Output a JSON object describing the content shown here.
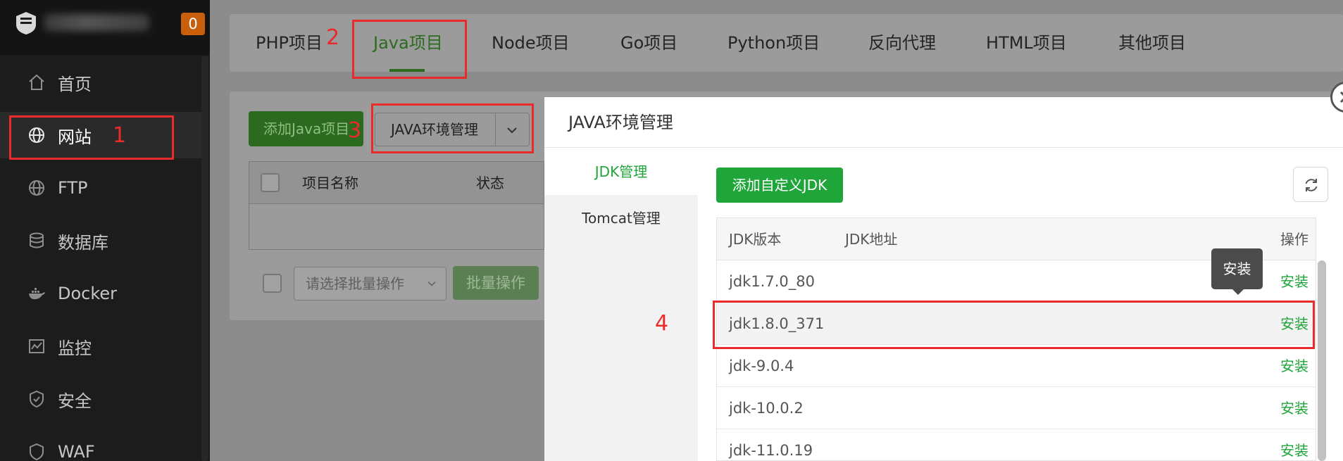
{
  "sidebar": {
    "badge": "0",
    "items": [
      {
        "label": "首页",
        "icon": "home-icon"
      },
      {
        "label": "网站",
        "icon": "globe-icon"
      },
      {
        "label": "FTP",
        "icon": "globe-icon"
      },
      {
        "label": "数据库",
        "icon": "database-icon"
      },
      {
        "label": "Docker",
        "icon": "docker-icon"
      },
      {
        "label": "监控",
        "icon": "monitor-icon"
      },
      {
        "label": "安全",
        "icon": "shield-icon"
      },
      {
        "label": "WAF",
        "icon": "waf-shield-icon"
      }
    ]
  },
  "tabs": [
    "PHP项目",
    "Java项目",
    "Node项目",
    "Go项目",
    "Python项目",
    "反向代理",
    "HTML项目",
    "其他项目"
  ],
  "toolbar": {
    "add_java_label": "添加Java项目",
    "java_env_label": "JAVA环境管理"
  },
  "project_table": {
    "headers": [
      "项目名称",
      "状态"
    ]
  },
  "bulk": {
    "select_placeholder": "请选择批量操作",
    "button_label": "批量操作"
  },
  "modal": {
    "title": "JAVA环境管理",
    "side_items": [
      "JDK管理",
      "Tomcat管理"
    ],
    "add_jdk_label": "添加自定义JDK",
    "table_headers": {
      "version": "JDK版本",
      "path": "JDK地址",
      "action": "操作"
    },
    "rows": [
      {
        "version": "jdk1.7.0_80",
        "action": "安装"
      },
      {
        "version": "jdk1.8.0_371",
        "action": "安装"
      },
      {
        "version": "jdk-9.0.4",
        "action": "安装"
      },
      {
        "version": "jdk-10.0.2",
        "action": "安装"
      },
      {
        "version": "jdk-11.0.19",
        "action": "安装"
      }
    ],
    "tooltip": "安装"
  },
  "annotations": [
    "1",
    "2",
    "3",
    "4"
  ],
  "colors": {
    "sidebar_bg": "#1c1c1d",
    "badge": "#c95f0b",
    "accent_green": "#20a53a",
    "annotation_red": "#ea2b2b"
  }
}
